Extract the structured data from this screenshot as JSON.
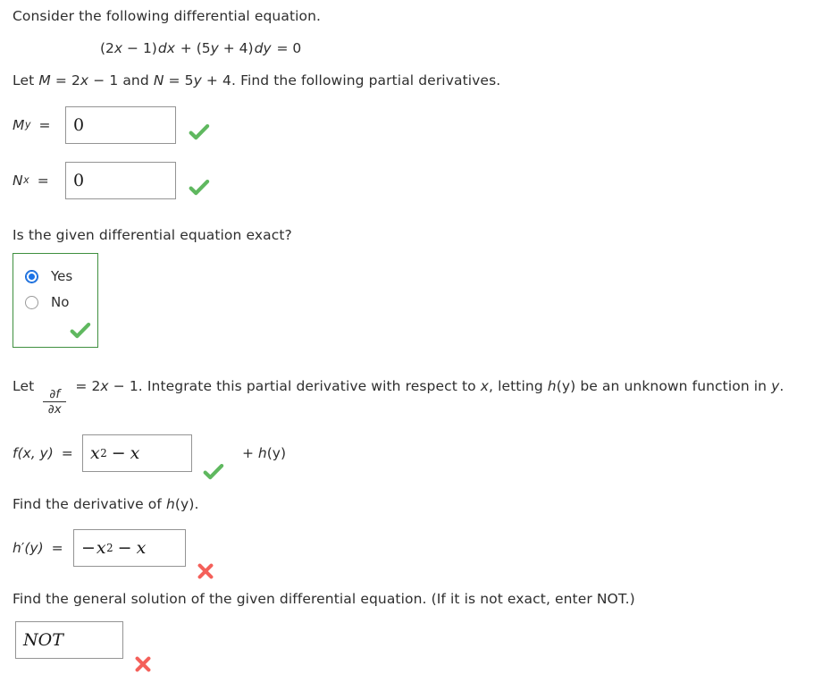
{
  "colors": {
    "correct": "#5fb85f",
    "incorrect": "#f4605a",
    "radio_selected": "#1a73e8",
    "group_border": "#3f8f3f",
    "input_border": "#949494",
    "text": "#2e2e2e"
  },
  "intro": {
    "line1": "Consider the following differential equation.",
    "equation": "(2x − 1) dx + (5y + 4) dy = 0",
    "equation_parts": {
      "open1": "(2",
      "var1": "x",
      "minus": " − 1)",
      "dx": "dx",
      "plus": " + (5",
      "var2": "y",
      "plus4": " + 4)",
      "dy": "dy",
      "equals": " = 0"
    },
    "line2_prefix": "Let ",
    "line2_M": "M",
    "line2_Meq": " = 2",
    "line2_Mx": "x",
    "line2_Mrest": " − 1 and ",
    "line2_N": "N",
    "line2_Neq": " = 5",
    "line2_Ny": "y",
    "line2_suffix": " + 4. Find the following partial derivatives."
  },
  "partials": [
    {
      "label_main": "M",
      "label_sub": "y",
      "equals": "=",
      "value": "0",
      "status": "correct",
      "status_name": "correct-check-icon"
    },
    {
      "label_main": "N",
      "label_sub": "x",
      "equals": "=",
      "value": "0",
      "status": "correct",
      "status_name": "correct-check-icon"
    }
  ],
  "exact_question": {
    "prompt": "Is the given differential equation exact?",
    "options": [
      {
        "label": "Yes",
        "selected": true
      },
      {
        "label": "No",
        "selected": false
      }
    ],
    "status": "correct"
  },
  "integrate_section": {
    "prefix": "Let ",
    "fraction_numerator": "∂f",
    "fraction_denominator": "∂x",
    "middle": " = 2",
    "middle_var": "x",
    "after": " − 1. Integrate this partial derivative with respect to ",
    "respect_var": "x",
    "after2": ", letting ",
    "h_fn": "h",
    "h_arg": "(y)",
    "tail": " be an unknown function in ",
    "tail_var": "y",
    "tail_end": "."
  },
  "f_row": {
    "label_f": "f",
    "label_args": "(x, y)",
    "equals": "=",
    "answer_base": "x",
    "answer_exp": "2",
    "answer_op": "−",
    "answer_tail": "x",
    "answer_full": "x² − x",
    "trailing_plus": "+ ",
    "trailing_h": "h",
    "trailing_arg": "(y)",
    "status": "correct"
  },
  "derivative_section": {
    "prompt_prefix": "Find the derivative of ",
    "prompt_h": "h",
    "prompt_arg": "(y)",
    "prompt_end": "."
  },
  "h_row": {
    "label_h": "h",
    "label_prime": "′",
    "label_args": "(y)",
    "equals": "=",
    "answer_sign": "−",
    "answer_base": "x",
    "answer_exp": "2",
    "answer_op": "−",
    "answer_tail": "x",
    "answer_full": "−x² − x",
    "status": "incorrect",
    "status_name": "incorrect-cross-icon"
  },
  "general_solution": {
    "prompt": "Find the general solution of the given differential equation. (If it is not exact, enter NOT.)",
    "value": "NOT",
    "status": "incorrect",
    "status_name": "incorrect-cross-icon"
  }
}
